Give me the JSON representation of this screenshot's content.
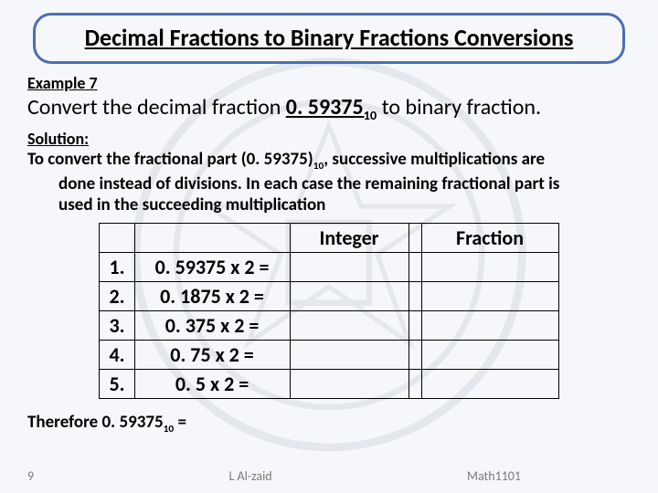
{
  "title": "Decimal Fractions to Binary Fractions Conversions",
  "example_label": "Example 7",
  "prompt_pre": "Convert the decimal fraction ",
  "prompt_value": "0. 59375",
  "prompt_value_sub": "10",
  "prompt_post": " to binary fraction.",
  "solution_label": "Solution:",
  "explain_line1": "To convert the fractional part (0. 59375)",
  "explain_sub": "10",
  "explain_line1b": ", successive multiplications are",
  "explain_line2": "done instead of divisions.  In each case the remaining fractional part is",
  "explain_line3": "used in the succeeding multiplication",
  "table": {
    "headers": {
      "integer": "Integer",
      "fraction": "Fraction"
    },
    "rows": [
      {
        "n": "1.",
        "expr": "0. 59375 x 2 ="
      },
      {
        "n": "2.",
        "expr": "0. 1875 x 2 ="
      },
      {
        "n": "3.",
        "expr": "0. 375 x 2 ="
      },
      {
        "n": "4.",
        "expr": "0. 75 x 2 ="
      },
      {
        "n": "5.",
        "expr": "0. 5 x 2 ="
      }
    ]
  },
  "therefore_pre": "Therefore ",
  "therefore_val": "0. 59375",
  "therefore_sub": "10",
  "therefore_post": " =",
  "footer": {
    "page": "9",
    "author": "L Al-zaid",
    "course": "Math1101"
  }
}
